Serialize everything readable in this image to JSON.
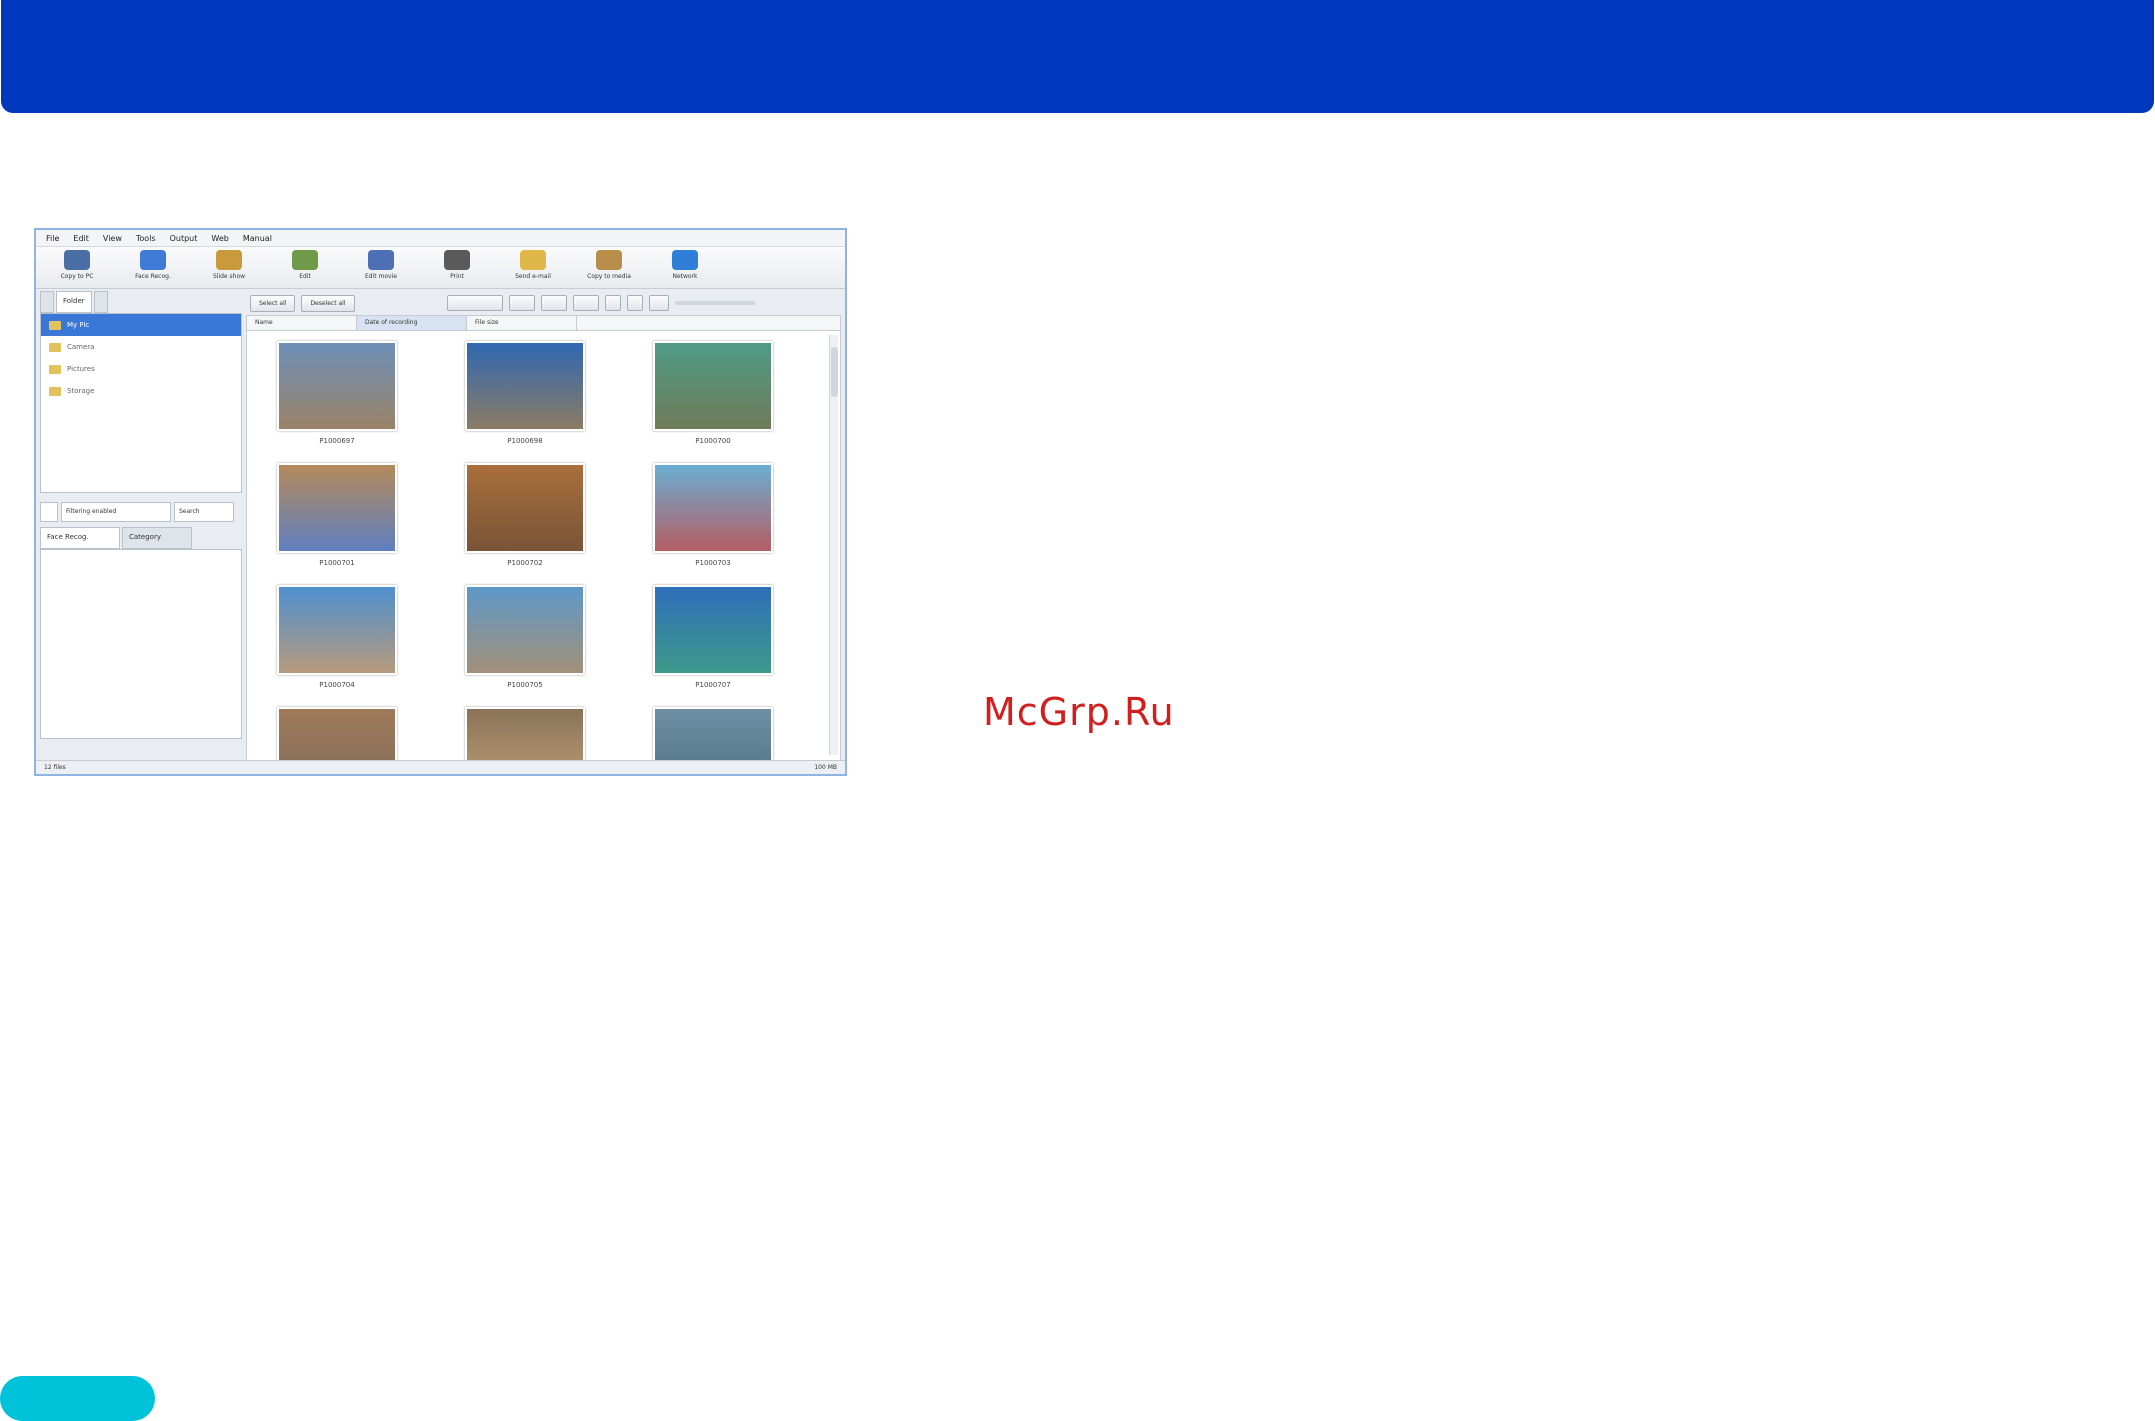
{
  "watermark": "McGrp.Ru",
  "screenshot": {
    "menu": [
      "File",
      "Edit",
      "View",
      "Tools",
      "Output",
      "Web",
      "Manual"
    ],
    "toolbar": [
      {
        "label": "Copy to PC",
        "color": "#4a6fa5"
      },
      {
        "label": "Face Recog.",
        "color": "#3f7ad6"
      },
      {
        "label": "Slide show",
        "color": "#c99a3c"
      },
      {
        "label": "Edit",
        "color": "#6e9a4a"
      },
      {
        "label": "Edit movie",
        "color": "#4d6fb3"
      },
      {
        "label": "Print",
        "color": "#5a5a5a"
      },
      {
        "label": "Send e-mail",
        "color": "#e0b84a"
      },
      {
        "label": "Copy to media",
        "color": "#b98e4a"
      },
      {
        "label": "Network",
        "color": "#2f7fd8"
      }
    ],
    "left_tabs": [
      "",
      "Folder",
      ""
    ],
    "tree": [
      {
        "label": "My Pic",
        "count": "",
        "selected": true
      },
      {
        "label": "Camera",
        "count": "",
        "selected": false
      },
      {
        "label": "Pictures",
        "count": "",
        "selected": false
      },
      {
        "label": "Storage",
        "count": "",
        "selected": false
      }
    ],
    "filter": {
      "field": "Filtering enabled",
      "button": "Search"
    },
    "lower_tabs": [
      "Face Recog.",
      "Category"
    ],
    "right_buttons": [
      "Select all",
      "Deselect all"
    ],
    "columns": [
      "Name",
      "Date of recording",
      "File size"
    ],
    "thumbs": [
      {
        "caption": "P1000697",
        "top": "#6d8fb8",
        "bottom": "#9a8266"
      },
      {
        "caption": "P1000698",
        "top": "#2f68b2",
        "bottom": "#8c7b63"
      },
      {
        "caption": "P1000700",
        "top": "#4f9b86",
        "bottom": "#6e7b58"
      },
      {
        "caption": "P1000701",
        "top": "#b58a5a",
        "bottom": "#5f7fc0"
      },
      {
        "caption": "P1000702",
        "top": "#a96f3b",
        "bottom": "#7a5438"
      },
      {
        "caption": "P1000703",
        "top": "#6aaed2",
        "bottom": "#b45e64"
      },
      {
        "caption": "P1000704",
        "top": "#4f8fd0",
        "bottom": "#b79a7c"
      },
      {
        "caption": "P1000705",
        "top": "#5d98c8",
        "bottom": "#a39079"
      },
      {
        "caption": "P1000707",
        "top": "#2d6fb9",
        "bottom": "#3d9a8a"
      },
      {
        "caption": "",
        "top": "#a07a5a",
        "bottom": "#7e6b5b"
      },
      {
        "caption": "",
        "top": "#8a7358",
        "bottom": "#c1a27a"
      },
      {
        "caption": "",
        "top": "#6f8fa5",
        "bottom": "#4f6f7f"
      }
    ],
    "status_left": "12 files",
    "status_right": "100 MB"
  }
}
